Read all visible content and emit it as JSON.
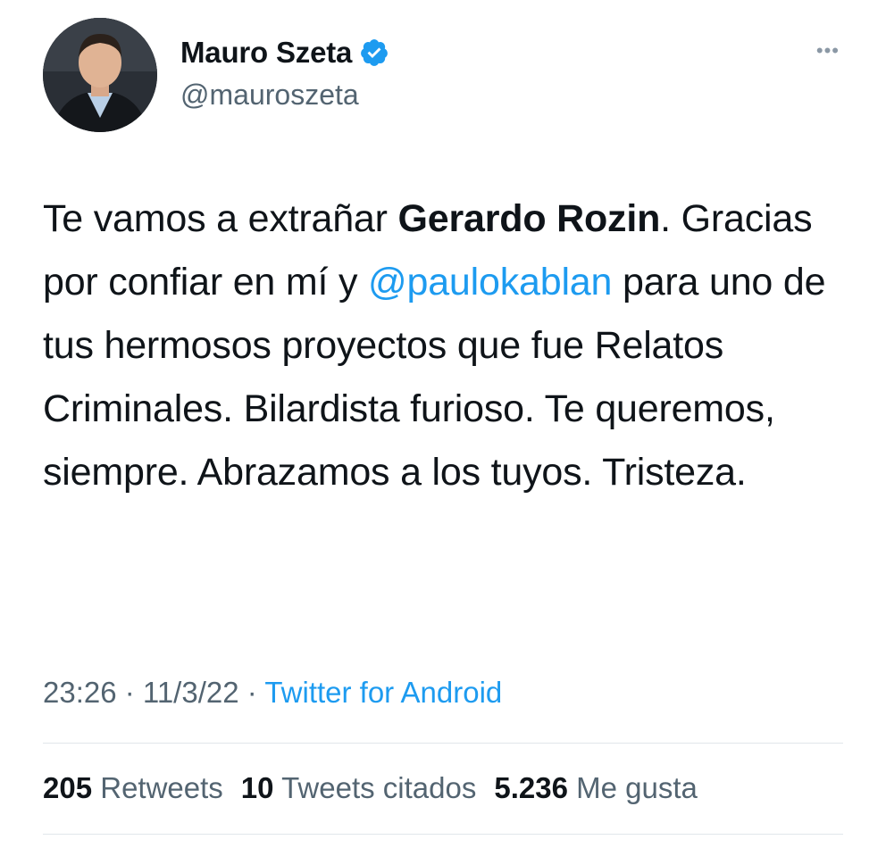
{
  "author": {
    "name": "Mauro Szeta",
    "handle": "@mauroszeta",
    "verified_icon": "verified-badge-icon",
    "avatar_icon": "profile-photo"
  },
  "more_label": "•••",
  "tweet": {
    "part1": "Te vamos a extrañar ",
    "bold": "Gerardo Rozin",
    "part2": ". Gracias por confiar en mí y ",
    "mention": "@paulokablan",
    "part3": " para uno de tus hermosos proyectos que fue Relatos Criminales. Bilardista furioso. Te queremos, siempre. Abrazamos a los tuyos. Tristeza."
  },
  "meta": {
    "time": "23:26",
    "sep1": " · ",
    "date": "11/3/22",
    "sep2": " · ",
    "source": "Twitter for Android"
  },
  "stats": {
    "retweets_count": "205",
    "retweets_label": "Retweets",
    "quotes_count": "10",
    "quotes_label": "Tweets citados",
    "likes_count": "5.236",
    "likes_label": "Me gusta"
  },
  "colors": {
    "link": "#1d9bf0",
    "secondary_text": "#536471",
    "primary_text": "#0f1419"
  }
}
